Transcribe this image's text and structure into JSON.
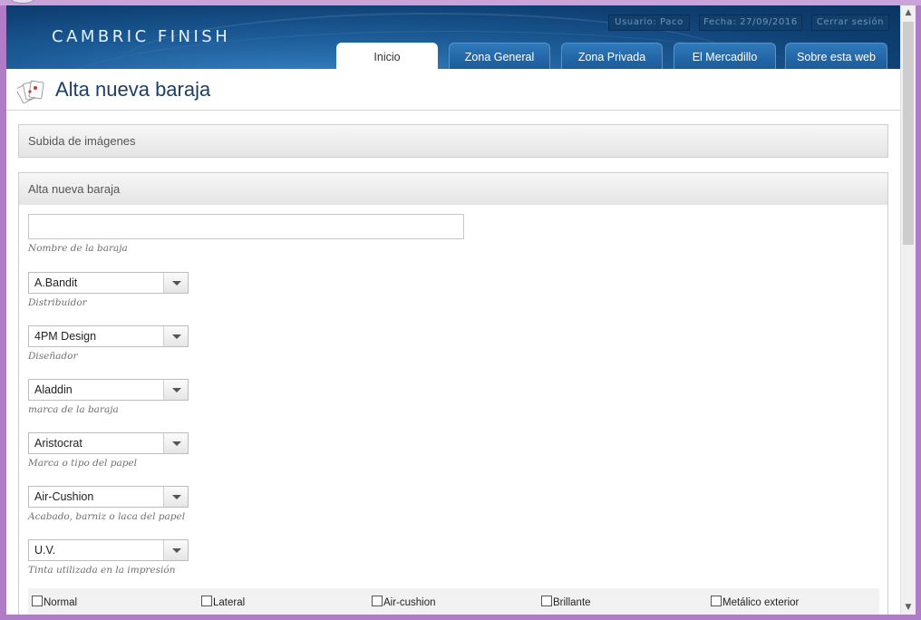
{
  "header": {
    "brand": "CAMBRIC FINISH",
    "user": "Usuario: Paco",
    "date": "Fecha: 27/09/2016",
    "logout": "Cerrar sesión"
  },
  "tabs": [
    {
      "label": "Inicio",
      "active": true
    },
    {
      "label": "Zona General",
      "active": false
    },
    {
      "label": "Zona Privada",
      "active": false
    },
    {
      "label": "El Mercadillo",
      "active": false
    },
    {
      "label": "Sobre esta web",
      "active": false
    }
  ],
  "page": {
    "title": "Alta nueva baraja"
  },
  "panels": {
    "upload": "Subida de imágenes",
    "new_deck": "Alta nueva baraja"
  },
  "form": {
    "name": {
      "value": "",
      "hint": "Nombre de la baraja"
    },
    "fields": [
      {
        "value": "A.Bandit",
        "hint": "Distribuidor"
      },
      {
        "value": "4PM Design",
        "hint": "Diseñador"
      },
      {
        "value": "Aladdin",
        "hint": "marca de la baraja"
      },
      {
        "value": "Aristocrat",
        "hint": "Marca o tipo del papel"
      },
      {
        "value": "Air-Cushion",
        "hint": "Acabado, barniz o laca del papel"
      },
      {
        "value": "U.V.",
        "hint": "Tinta utilizada en la impresión"
      }
    ],
    "checkboxes": [
      {
        "label": "Normal",
        "checked": false
      },
      {
        "label": "Lateral",
        "checked": false
      },
      {
        "label": "Air-cushion",
        "checked": false
      },
      {
        "label": "Brillante",
        "checked": false
      },
      {
        "label": "Metálico exterior",
        "checked": false
      }
    ]
  },
  "colors": {
    "header_dark": "#0e3f72",
    "header_light": "#3b86c6",
    "title": "#1d3f66",
    "frame": "#b07cc6"
  },
  "icons": [
    "cards-icon",
    "chevron-down-icon",
    "scroll-up-icon",
    "scroll-down-icon"
  ]
}
